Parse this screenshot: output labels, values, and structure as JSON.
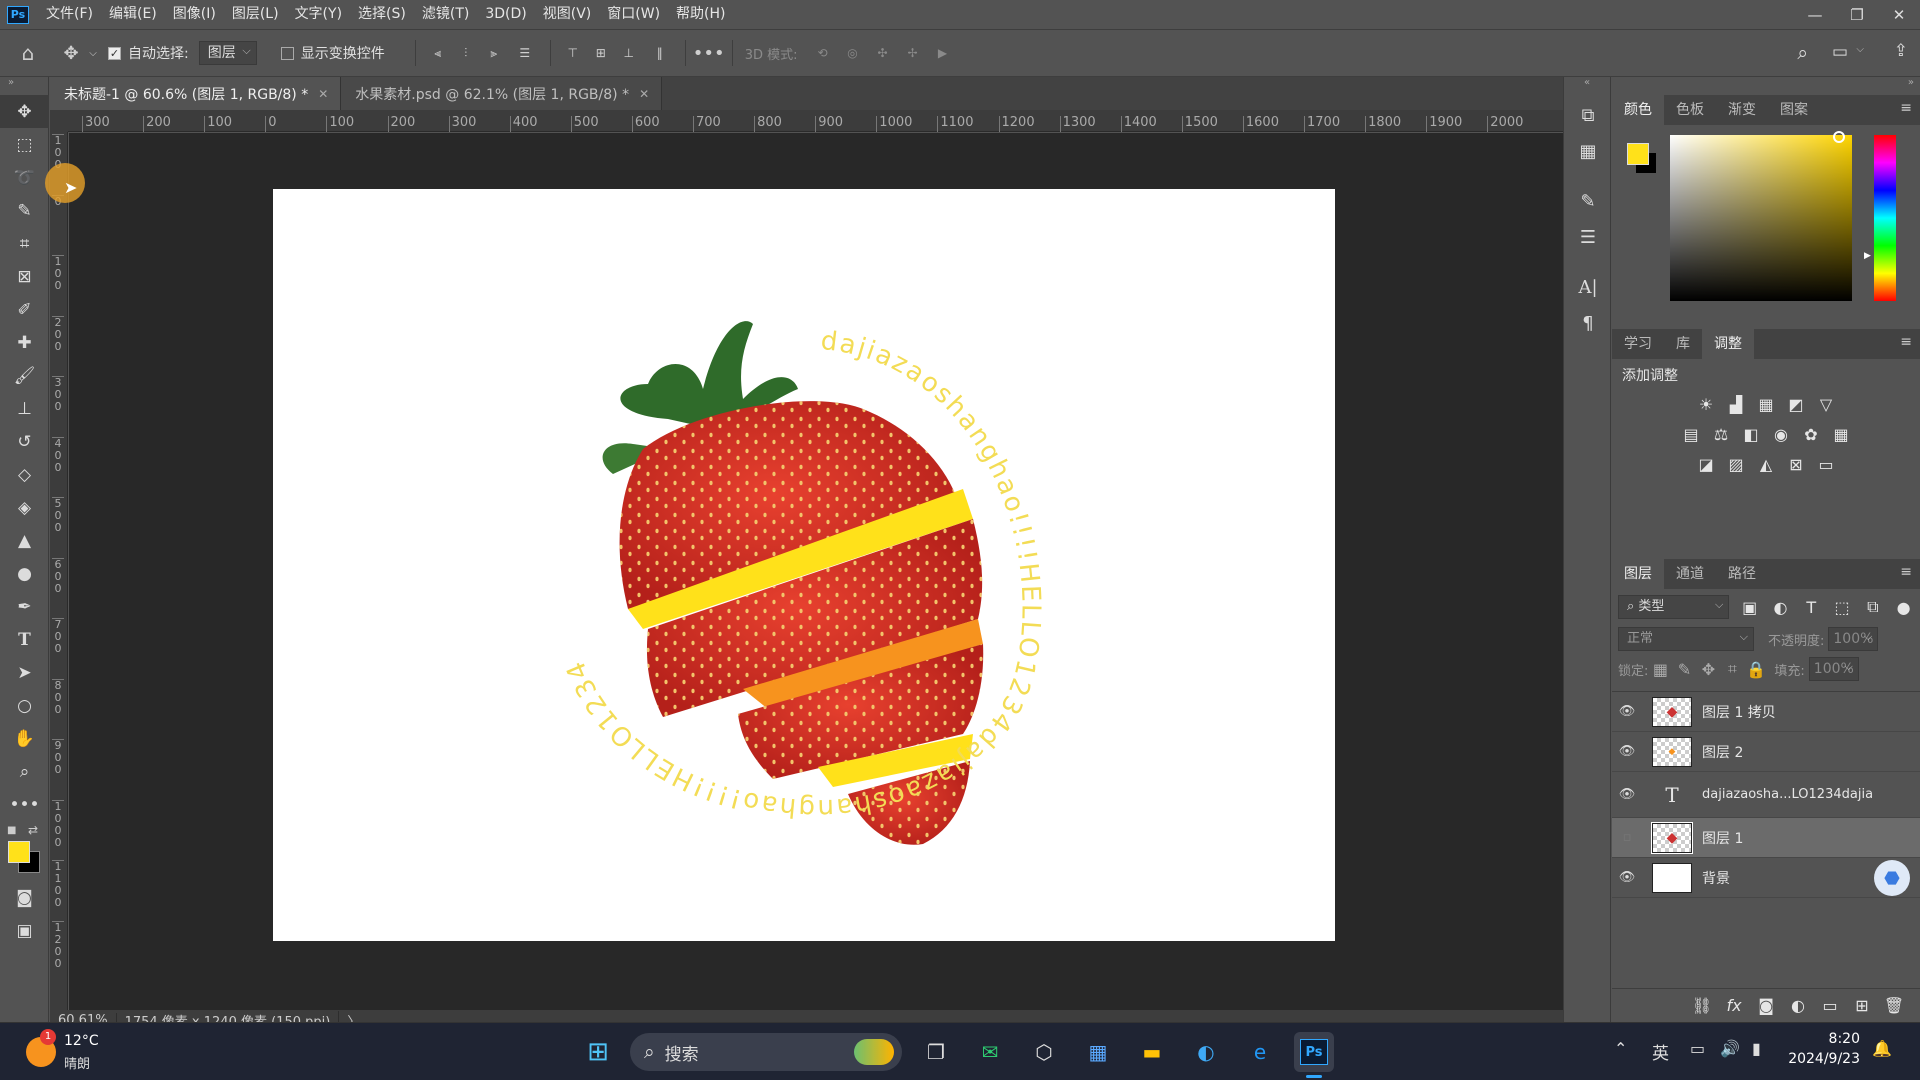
{
  "app": {
    "logo": "Ps"
  },
  "menu": [
    "文件(F)",
    "编辑(E)",
    "图像(I)",
    "图层(L)",
    "文字(Y)",
    "选择(S)",
    "滤镜(T)",
    "3D(D)",
    "视图(V)",
    "窗口(W)",
    "帮助(H)"
  ],
  "options": {
    "auto_select_label": "自动选择:",
    "auto_select_value": "图层",
    "show_transform_label": "显示变换控件",
    "mode_3d_label": "3D 模式:"
  },
  "tabs": [
    {
      "label": "未标题-1 @ 60.6% (图层 1, RGB/8) *"
    },
    {
      "label": "水果素材.psd @ 62.1% (图层 1, RGB/8) *"
    }
  ],
  "hruler": [
    "300",
    "200",
    "100",
    "0",
    "100",
    "200",
    "300",
    "400",
    "500",
    "600",
    "700",
    "800",
    "900",
    "1000",
    "1100",
    "1200",
    "1300",
    "1400",
    "1500",
    "1600",
    "1700",
    "1800",
    "1900",
    "2000"
  ],
  "vruler": [
    "100",
    "0",
    "100",
    "200",
    "300",
    "400",
    "500",
    "600",
    "700",
    "800",
    "900",
    "1000",
    "1100",
    "1200"
  ],
  "canvas": {
    "circle_text": "dajiazaoshanghao!!!!HELLO1234dajiazaoshanghao!!!!HELLO1234"
  },
  "status": {
    "zoom": "60.61%",
    "size": "1754 像素 x 1240 像素 (150 ppi)",
    "arrow": "〉"
  },
  "color_panel": {
    "tabs": [
      "颜色",
      "色板",
      "渐变",
      "图案"
    ],
    "fg": "#ffe11a",
    "bg": "#000000"
  },
  "adjust_panel": {
    "tabs": [
      "学习",
      "库",
      "调整"
    ],
    "title": "添加调整"
  },
  "layers_panel": {
    "tabs": [
      "图层",
      "通道",
      "路径"
    ],
    "filter": "类型",
    "blend": "正常",
    "opacity_label": "不透明度:",
    "opacity": "100%",
    "lock_label": "锁定:",
    "fill_label": "填充:",
    "fill": "100%",
    "layers": [
      {
        "name": "图层 1 拷贝",
        "visible": true
      },
      {
        "name": "图层 2",
        "visible": true
      },
      {
        "name": "dajiazaosha...LO1234dajia",
        "visible": true
      },
      {
        "name": "图层 1",
        "visible": false
      },
      {
        "name": "背景",
        "visible": true
      }
    ]
  },
  "taskbar": {
    "temp": "12°C",
    "weather": "晴朗",
    "badge": "1",
    "search": "搜索",
    "ime": "英",
    "time": "8:20",
    "date": "2024/9/23"
  },
  "colors": {
    "accent": "#31a8ff",
    "yellow": "#ffe11a",
    "orange": "#f7931e"
  }
}
